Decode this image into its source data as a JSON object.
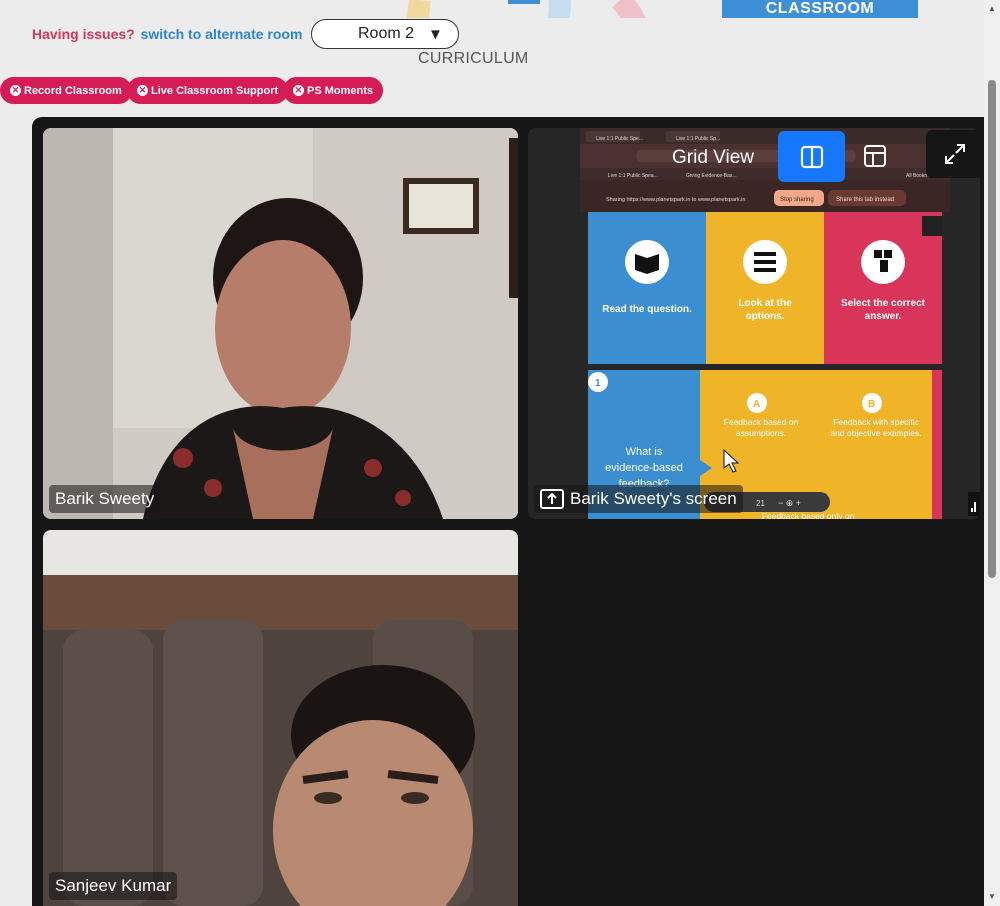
{
  "banner": {
    "label": "CLASSROOM"
  },
  "header": {
    "issue_prefix": "Having issues?",
    "issue_link": "switch to alternate room",
    "room_select_value": "Room 2",
    "section_title": "CURRICULUM"
  },
  "actions": {
    "record": "Record Classroom",
    "support": "Live Classroom Support",
    "moments": "PS Moments"
  },
  "controls": {
    "view_label": "Grid View"
  },
  "participants": [
    {
      "name": "Barik Sweety"
    },
    {
      "name": "Barik Sweety's screen"
    },
    {
      "name": "Sanjeev Kumar"
    }
  ],
  "shared_screen": {
    "tabs": [
      "Live 1:1 Public Spe...",
      "Live 1:1 Public Sp...",
      "Giving Evidence-Bas..."
    ],
    "share_notice": "Sharing https://www.planetspark.in to www.planetspark.in",
    "stop_sharing": "Stop sharing",
    "share_this_tab": "Share this tab instead",
    "all_bookmarks": "All Bookmarks",
    "cards": [
      {
        "text": "Read the question.",
        "color": "#3b8fd1"
      },
      {
        "text": "Look at the options.",
        "color": "#f0b429"
      },
      {
        "text": "Select the correct answer.",
        "color": "#d9355a"
      }
    ],
    "question_number": "1",
    "question": "What is evidence-based feedback?",
    "option_a_letter": "A",
    "option_a": "Feedback based on assumptions.",
    "option_b_letter": "B",
    "option_b": "Feedback with specific and objective examples.",
    "option_c": "Feedback based only on",
    "page_total": "21"
  },
  "colors": {
    "accent": "#d51c56",
    "link": "#2e86d2",
    "primary_button": "#1677ff"
  }
}
